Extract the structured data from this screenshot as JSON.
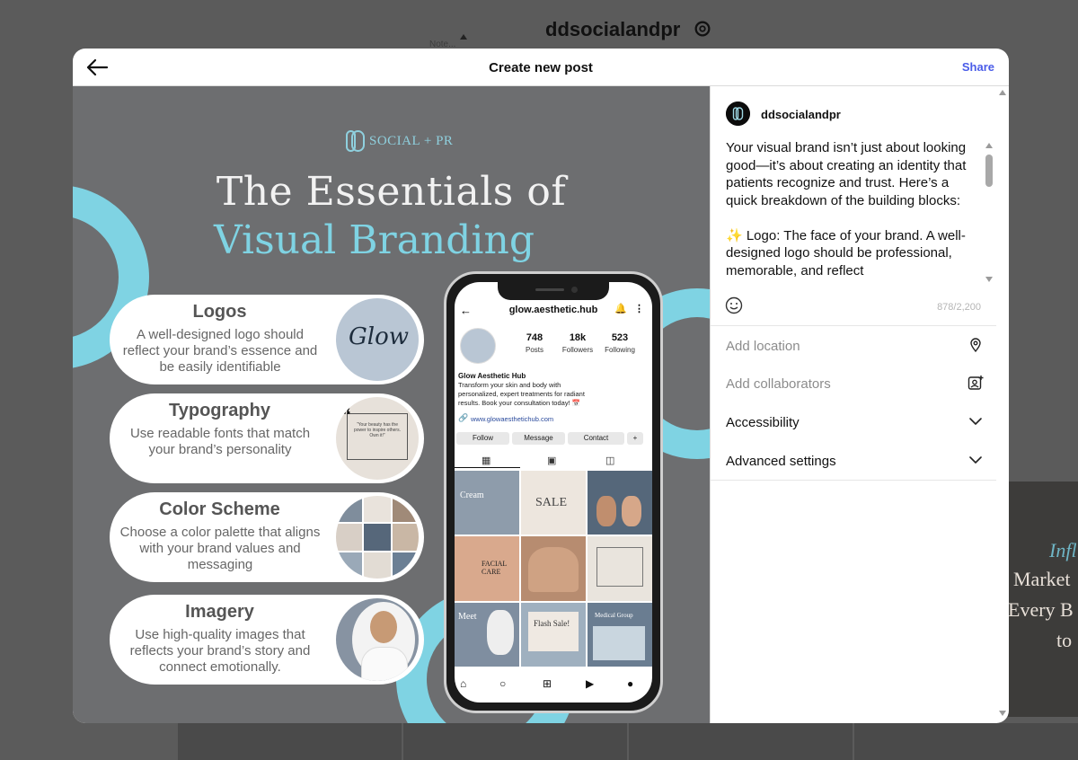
{
  "background": {
    "note_label": "Note...",
    "profile_username": "ddsocialandpr",
    "side_post_lines": [
      "Infl",
      "Market",
      "Every B",
      "to"
    ]
  },
  "modal": {
    "title": "Create new post",
    "share_label": "Share"
  },
  "post_image": {
    "brand_logo_text": "SOCIAL + PR",
    "headline_line1": "The Essentials of",
    "headline_line2": "Visual Branding",
    "cards": [
      {
        "title": "Logos",
        "description": "A well-designed logo should reflect your brand’s essence and be easily identifiable"
      },
      {
        "title": "Typography",
        "description": "Use readable fonts that match your brand’s personality"
      },
      {
        "title": "Color Scheme",
        "description": "Choose a color palette that aligns with your brand values and messaging"
      },
      {
        "title": "Imagery",
        "description": "Use high-quality images that reflects your brand’s story and connect emotionally."
      }
    ],
    "logo_thumb_text": "Glow",
    "typo_thumb_text": "“Your beauty has the power to inspire others. Own it!”",
    "phone": {
      "username": "glow.aesthetic.hub",
      "stats": [
        {
          "number": "748",
          "label": "Posts"
        },
        {
          "number": "18k",
          "label": "Followers"
        },
        {
          "number": "523",
          "label": "Following"
        }
      ],
      "display_name": "Glow Aesthetic Hub",
      "bio": "Transform your skin and body with personalized, expert treatments for radiant results. Book your consultation today! 📅",
      "link": "www.glowaesthetichub.com",
      "buttons": [
        "Follow",
        "Message",
        "Contact"
      ],
      "grid_texts": [
        "Cream",
        "SALE",
        "",
        "FACIAL CARE",
        "",
        "",
        "Meet",
        "Flash Sale!",
        "Medical Group"
      ]
    }
  },
  "side_panel": {
    "account_name": "ddsocialandpr",
    "caption": "Your visual brand isn’t just about looking good—it’s about creating an identity that patients recognize and trust. Here’s a quick breakdown of the building blocks:\n\n✨ Logo: The face of your brand. A well-designed logo should be professional, memorable, and reflect",
    "char_count": "878/2,200",
    "options": {
      "location": "Add location",
      "collaborators": "Add collaborators",
      "accessibility": "Accessibility",
      "advanced": "Advanced settings"
    }
  },
  "colors": {
    "accent_blue": "#4a5ce8",
    "image_bg": "#6d6e70",
    "teal": "#7fd3e3"
  }
}
